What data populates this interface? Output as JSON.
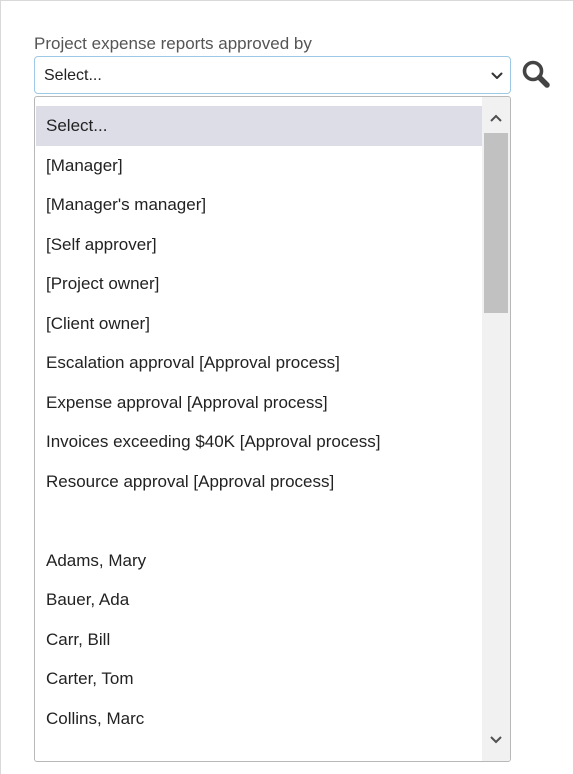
{
  "field": {
    "label": "Project expense reports approved by",
    "selected_value": "Select..."
  },
  "icons": {
    "dropdown_arrow": "chevron-down-icon",
    "search": "search-icon"
  },
  "dropdown": {
    "options": [
      "Select...",
      "[Manager]",
      "[Manager's manager]",
      "[Self approver]",
      "[Project owner]",
      "[Client owner]",
      "Escalation approval [Approval process]",
      "Expense approval [Approval process]",
      "Invoices exceeding $40K [Approval process]",
      "Resource approval [Approval process]",
      "",
      "Adams, Mary",
      "Bauer, Ada",
      "Carr, Bill",
      "Carter, Tom",
      "Collins, Marc"
    ],
    "selected_index": 0
  },
  "colors": {
    "selected_option_bg": "#dcdde6",
    "select_border": "#9ec9e6",
    "scroll_thumb": "#c1c1c1",
    "scroll_track": "#f1f1f1"
  }
}
